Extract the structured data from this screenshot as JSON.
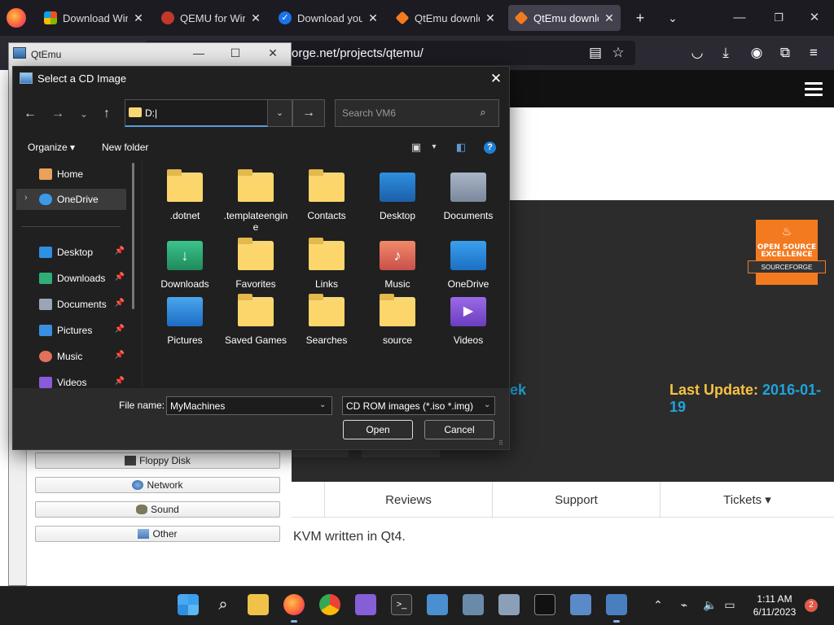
{
  "browser": {
    "tabs": [
      {
        "label": "Download Wind",
        "favicon_color": "#f25022"
      },
      {
        "label": "QEMU for Windo",
        "favicon_color": "#e05a2b"
      },
      {
        "label": "Download your",
        "favicon_color": "#1a73e8"
      },
      {
        "label": "QtEmu downloa",
        "favicon_color": "#f47a20"
      },
      {
        "label": "QtEmu downloa",
        "favicon_color": "#f47a20"
      }
    ],
    "url": "orge.net/projects/qtemu/"
  },
  "webpage": {
    "last_update_label": "Last Update:",
    "last_update_date": "2016-01-19",
    "ek_fragment": "ek",
    "badge_line1": "OPEN SOURCE",
    "badge_line2": "EXCELLENCE",
    "badge_ribbon": "SOURCEFORGE",
    "tabs": [
      "Reviews",
      "Support",
      "Tickets ▾"
    ],
    "description_fragment": "l KVM written in Qt4."
  },
  "qtemu": {
    "title": "QtEmu",
    "buttons": [
      "Floppy Disk",
      "Network",
      "Sound",
      "Other"
    ]
  },
  "dialog": {
    "title": "Select a CD Image",
    "path": "D:|",
    "search_placeholder": "Search VM6",
    "organize": "Organize",
    "new_folder": "New folder",
    "nav_items": [
      {
        "label": "Home"
      },
      {
        "label": "OneDrive"
      },
      {
        "label": "Desktop"
      },
      {
        "label": "Downloads"
      },
      {
        "label": "Documents"
      },
      {
        "label": "Pictures"
      },
      {
        "label": "Music"
      },
      {
        "label": "Videos"
      }
    ],
    "files": [
      ".dotnet",
      ".templateengine",
      "Contacts",
      "Desktop",
      "Documents",
      "Downloads",
      "Favorites",
      "Links",
      "Music",
      "OneDrive",
      "Pictures",
      "Saved Games",
      "Searches",
      "source",
      "Videos"
    ],
    "file_name_label": "File name:",
    "file_name_value": "MyMachines",
    "filter": "CD ROM images (*.iso *.img)",
    "open_label": "Open",
    "cancel_label": "Cancel"
  },
  "taskbar": {
    "time": "1:11 AM",
    "date": "6/11/2023",
    "notification_count": "2"
  },
  "colors": {
    "accent_blue": "#1fa4dc",
    "accent_yellow": "#f5c242",
    "sourceforge_orange": "#f47a20"
  }
}
